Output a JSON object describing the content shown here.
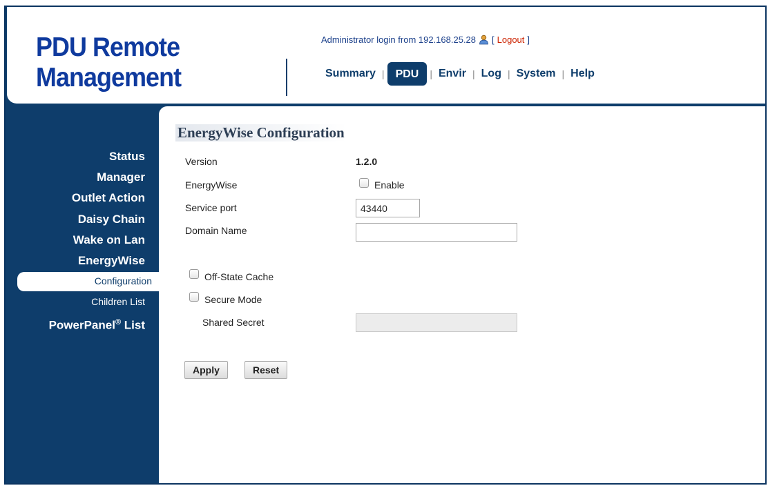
{
  "header": {
    "brand_line1": "PDU Remote",
    "brand_line2": "Management",
    "admin_text": "Administrator login from 192.168.25.28",
    "user_icon": "user-icon",
    "logout_label": "Logout"
  },
  "nav": {
    "items": [
      {
        "label": "Summary"
      },
      {
        "label": "PDU",
        "active": true
      },
      {
        "label": "Envir"
      },
      {
        "label": "Log"
      },
      {
        "label": "System"
      },
      {
        "label": "Help"
      }
    ]
  },
  "sidebar": {
    "items": [
      {
        "label": "Status"
      },
      {
        "label": "Manager"
      },
      {
        "label": "Outlet Action"
      },
      {
        "label": "Daisy Chain"
      },
      {
        "label": "Wake on Lan"
      },
      {
        "label": "EnergyWise"
      }
    ],
    "subitems": [
      {
        "label": "Configuration",
        "active": true
      },
      {
        "label": "Children List"
      }
    ],
    "powerpanel_label": "PowerPanel",
    "powerpanel_sup": "®",
    "powerpanel_suffix": " List"
  },
  "main": {
    "title": "EnergyWise Configuration",
    "version_label": "Version",
    "version_value": "1.2.0",
    "energywise_label": "EnergyWise",
    "enable_label": "Enable",
    "enable_checked": false,
    "service_port_label": "Service port",
    "service_port_value": "43440",
    "domain_name_label": "Domain Name",
    "domain_name_value": "",
    "off_state_cache_label": "Off-State Cache",
    "off_state_cache_checked": false,
    "secure_mode_label": "Secure Mode",
    "secure_mode_checked": false,
    "shared_secret_label": "Shared Secret",
    "shared_secret_value": "",
    "apply_label": "Apply",
    "reset_label": "Reset"
  },
  "colors": {
    "brand": "#0f3a9e",
    "navy": "#0e3d6b",
    "logout": "#cc2200"
  }
}
